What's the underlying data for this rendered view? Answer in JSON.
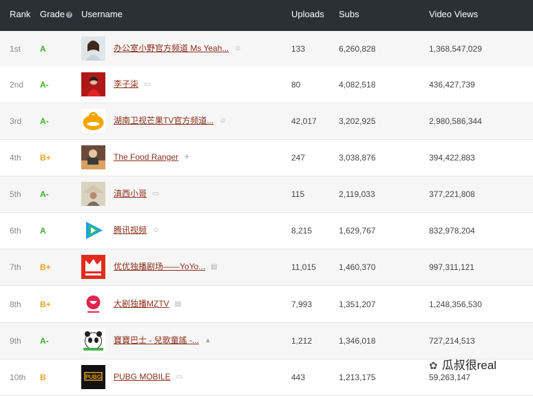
{
  "header": {
    "rank": "Rank",
    "grade": "Grade",
    "username": "Username",
    "uploads": "Uploads",
    "subs": "Subs",
    "views": "Video Views"
  },
  "colors": {
    "header_bg": "#2b3034",
    "grade_green": "#3fae2a",
    "grade_orange": "#e8a21d",
    "link": "#8b2e1a"
  },
  "rows": [
    {
      "rank": "1st",
      "grade": "A",
      "grade_color": "#3fae2a",
      "username": "办公室小野官方频道 Ms Yeah...",
      "badge_icon": "people-icon",
      "uploads": "133",
      "subs": "6,260,828",
      "views": "1,368,547,029",
      "avatar": "woman-avatar"
    },
    {
      "rank": "2nd",
      "grade": "A-",
      "grade_color": "#3fae2a",
      "username": "李子柒",
      "badge_icon": "chat-icon",
      "uploads": "80",
      "subs": "4,082,518",
      "views": "436,427,739",
      "avatar": "red-dress-avatar"
    },
    {
      "rank": "3rd",
      "grade": "A-",
      "grade_color": "#3fae2a",
      "username": "湖南卫视芒果TV官方频道...",
      "badge_icon": "people-icon",
      "uploads": "42,017",
      "subs": "3,202,925",
      "views": "2,980,586,344",
      "avatar": "mango-logo"
    },
    {
      "rank": "4th",
      "grade": "B+",
      "grade_color": "#e8a21d",
      "username": "The Food Ranger",
      "badge_icon": "plane-icon",
      "uploads": "247",
      "subs": "3,038,876",
      "views": "394,422,883",
      "avatar": "food-ranger-avatar"
    },
    {
      "rank": "5th",
      "grade": "A-",
      "grade_color": "#3fae2a",
      "username": "滇西小哥",
      "badge_icon": "chat-icon",
      "uploads": "115",
      "subs": "2,119,033",
      "views": "377,221,808",
      "avatar": "hat-avatar"
    },
    {
      "rank": "6th",
      "grade": "A",
      "grade_color": "#3fae2a",
      "username": "腾讯视频",
      "badge_icon": "people-icon",
      "uploads": "8,215",
      "subs": "1,629,767",
      "views": "832,978,204",
      "avatar": "tencent-video-logo"
    },
    {
      "rank": "7th",
      "grade": "B+",
      "grade_color": "#e8a21d",
      "username": "优优独播剧场——YoYo...",
      "badge_icon": "film-icon",
      "uploads": "11,015",
      "subs": "1,460,370",
      "views": "997,311,121",
      "avatar": "youyou-logo"
    },
    {
      "rank": "8th",
      "grade": "B+",
      "grade_color": "#e8a21d",
      "username": "大剧独播MZTV",
      "badge_icon": "film-icon",
      "uploads": "7,993",
      "subs": "1,351,207",
      "views": "1,248,356,530",
      "avatar": "mztv-logo"
    },
    {
      "rank": "9th",
      "grade": "A-",
      "grade_color": "#3fae2a",
      "username": "寶寶巴士 - 兒歌童謠 -...",
      "badge_icon": "cap-icon",
      "uploads": "1,212",
      "subs": "1,346,018",
      "views": "727,214,513",
      "avatar": "panda-logo"
    },
    {
      "rank": "10th",
      "grade": "B",
      "grade_color": "#e8a21d",
      "username": "PUBG MOBILE",
      "badge_icon": "chat-icon",
      "uploads": "443",
      "subs": "1,213,175",
      "views": "59,263,147",
      "avatar": "pubg-logo"
    }
  ],
  "watermark": "瓜叔很real"
}
